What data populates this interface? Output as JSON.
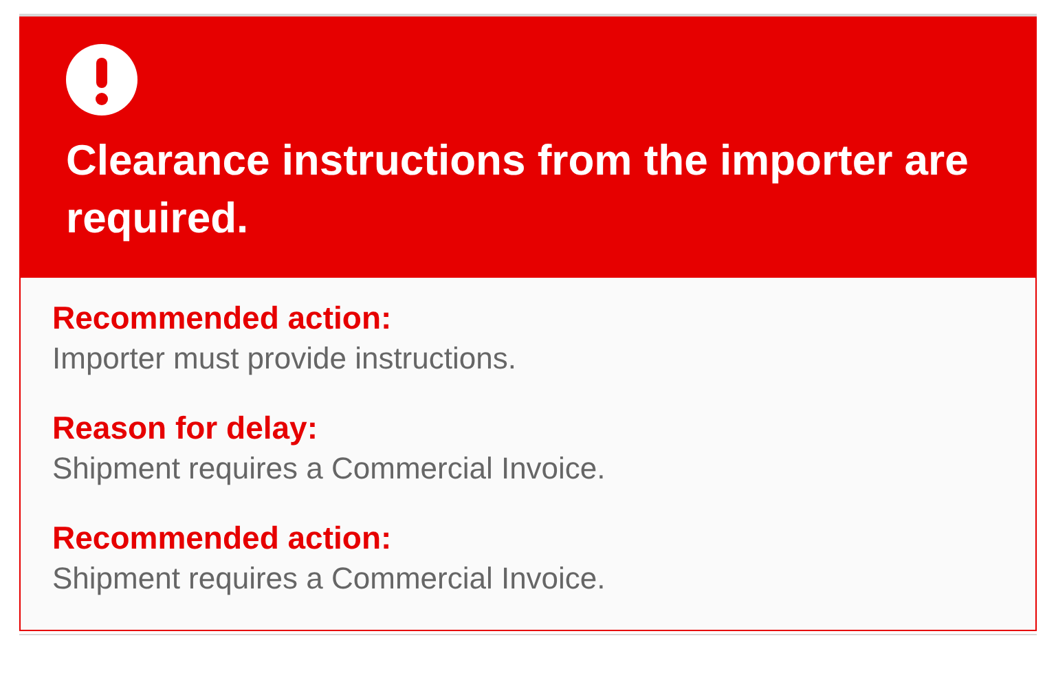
{
  "alert": {
    "title": "Clearance instructions from the importer are required.",
    "items": [
      {
        "label": "Recommended action:",
        "text": "Importer must provide instructions."
      },
      {
        "label": "Reason for delay:",
        "text": "Shipment requires a Commercial Invoice."
      },
      {
        "label": "Recommended action:",
        "text": "Shipment requires a Commercial Invoice."
      }
    ]
  }
}
